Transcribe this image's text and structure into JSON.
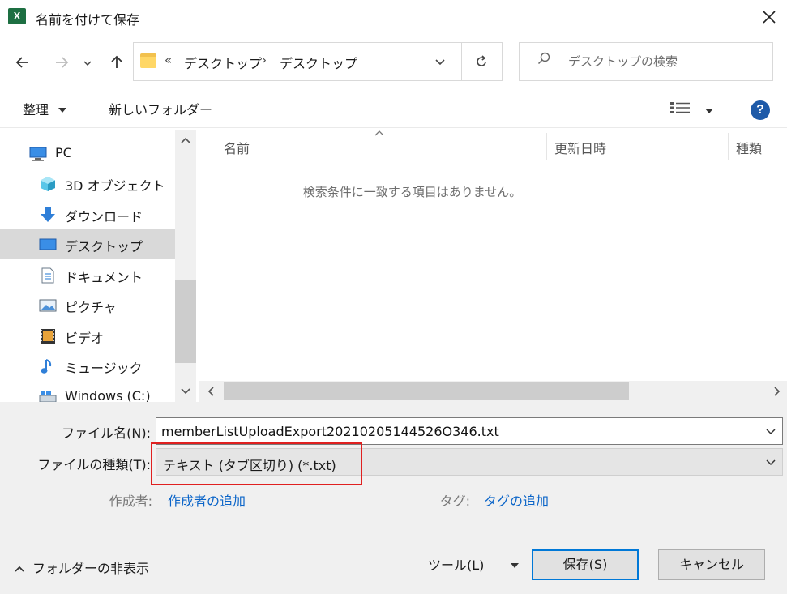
{
  "window": {
    "title": "名前を付けて保存",
    "app_icon_label": "X"
  },
  "address": {
    "overflow_chevron": "«",
    "crumbs": [
      "デスクトップ",
      "デスクトップ"
    ],
    "separator": "›"
  },
  "search": {
    "placeholder": "デスクトップの検索"
  },
  "toolbar": {
    "organize_label": "整理",
    "new_folder_label": "新しいフォルダー"
  },
  "nav": {
    "items": [
      {
        "label": "PC",
        "icon": "pc-icon"
      },
      {
        "label": "3D オブジェクト",
        "icon": "3d-objects-icon"
      },
      {
        "label": "ダウンロード",
        "icon": "download-icon"
      },
      {
        "label": "デスクトップ",
        "icon": "desktop-icon",
        "selected": true
      },
      {
        "label": "ドキュメント",
        "icon": "documents-icon"
      },
      {
        "label": "ピクチャ",
        "icon": "pictures-icon"
      },
      {
        "label": "ビデオ",
        "icon": "videos-icon"
      },
      {
        "label": "ミュージック",
        "icon": "music-icon"
      },
      {
        "label": "Windows (C:)",
        "icon": "drive-icon"
      }
    ]
  },
  "list": {
    "columns": [
      "名前",
      "更新日時",
      "種類"
    ],
    "empty_message": "検索条件に一致する項目はありません。"
  },
  "form": {
    "filename_label": "ファイル名(N):",
    "filename_value": "memberListUploadExport20210205144526O346.txt",
    "filetype_label": "ファイルの種類(T):",
    "filetype_value": "テキスト (タブ区切り) (*.txt)",
    "author_label": "作成者:",
    "author_link": "作成者の追加",
    "tag_label": "タグ:",
    "tag_link": "タグの追加"
  },
  "footer": {
    "hide_folders_label": "フォルダーの非表示",
    "tools_label": "ツール(L)",
    "save_label": "保存(S)",
    "cancel_label": "キャンセル"
  },
  "colors": {
    "accent": "#0078d7",
    "link": "#0a64c8",
    "highlight": "#e02020",
    "excel": "#1d6f42"
  }
}
